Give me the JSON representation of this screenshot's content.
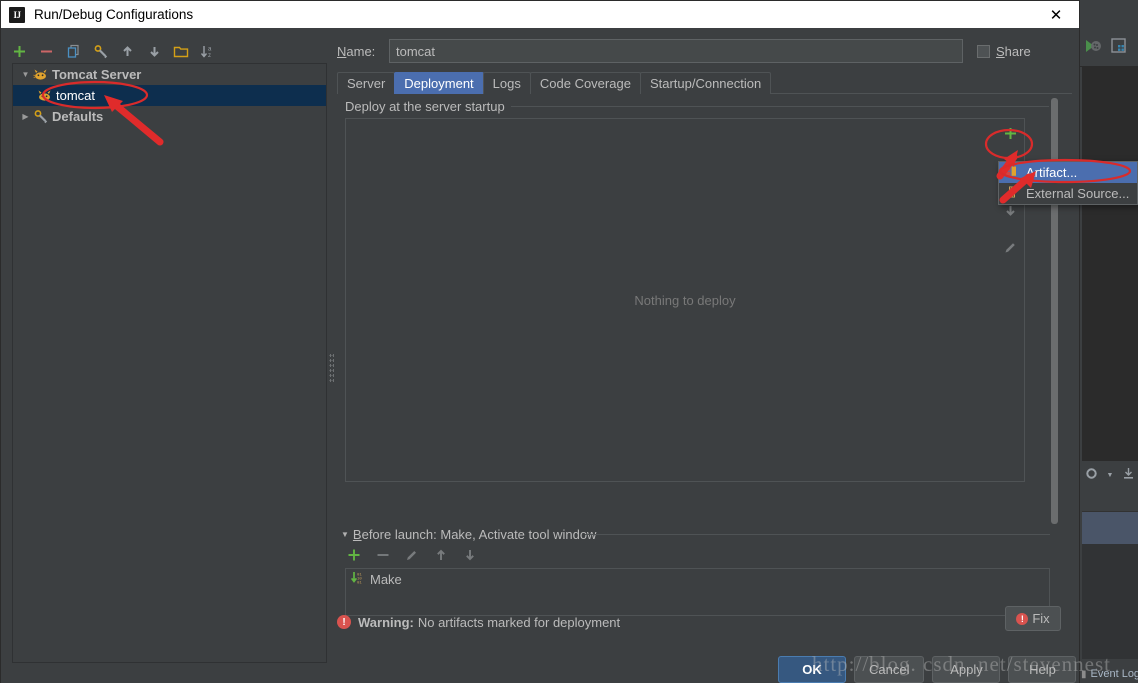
{
  "window": {
    "title": "Run/Debug Configurations",
    "logo_text": "IJ",
    "close_glyph": "✕"
  },
  "left_toolbar": {
    "items": [
      {
        "name": "add-configuration-button",
        "icon": "plus-icon",
        "glyph": "+"
      },
      {
        "name": "remove-configuration-button",
        "icon": "minus-icon",
        "glyph": "−"
      },
      {
        "name": "copy-configuration-button",
        "icon": "copy-icon",
        "glyph": "❐"
      },
      {
        "name": "edit-defaults-button",
        "icon": "wrench-icon",
        "glyph": "🔧"
      },
      {
        "name": "move-up-button",
        "icon": "arrow-up-icon",
        "glyph": "↑"
      },
      {
        "name": "move-down-button",
        "icon": "arrow-down-icon",
        "glyph": "↓"
      },
      {
        "name": "create-folder-button",
        "icon": "folder-icon",
        "glyph": "🗀"
      },
      {
        "name": "sort-configurations-button",
        "icon": "sort-az-icon",
        "glyph": "↓"
      }
    ]
  },
  "tree": {
    "nodes": [
      {
        "label": "Tomcat Server",
        "icon": "tomcat-icon",
        "expanded": true,
        "selected": false,
        "level": 0,
        "twisty": "▼"
      },
      {
        "label": "tomcat",
        "icon": "tomcat-icon",
        "expanded": false,
        "selected": true,
        "level": 1,
        "twisty": ""
      },
      {
        "label": "Defaults",
        "icon": "wrench-icon",
        "expanded": false,
        "selected": false,
        "level": 0,
        "twisty": "▶"
      }
    ]
  },
  "form": {
    "name_label": "Name:",
    "name_label_mnemonic": "N",
    "name_value": "tomcat",
    "share_label": "Share",
    "share_label_mnemonic": "S",
    "share_checked": false
  },
  "tabs": [
    {
      "label": "Server",
      "active": false
    },
    {
      "label": "Deployment",
      "active": true
    },
    {
      "label": "Logs",
      "active": false
    },
    {
      "label": "Code Coverage",
      "active": false
    },
    {
      "label": "Startup/Connection",
      "active": false
    }
  ],
  "deployment": {
    "group_label": "Deploy at the server startup",
    "empty_text": "Nothing to deploy",
    "toolbar": [
      {
        "name": "add-deployment-button",
        "icon": "plus-icon",
        "glyph": "+"
      },
      {
        "name": "move-deployment-down-button",
        "icon": "arrow-down-icon",
        "glyph": "↓"
      },
      {
        "name": "edit-deployment-button",
        "icon": "pencil-icon",
        "glyph": "✎"
      }
    ]
  },
  "popup_menu": {
    "items": [
      {
        "label": "Artifact...",
        "icon": "artifact-icon",
        "highlighted": true
      },
      {
        "label": "External Source...",
        "icon": "external-source-icon",
        "highlighted": false
      }
    ]
  },
  "before_launch": {
    "header": "Before launch: Make, Activate tool window",
    "header_mnemonic": "B",
    "twisty": "▼",
    "toolbar": [
      {
        "name": "add-task-button",
        "icon": "plus-icon",
        "glyph": "+"
      },
      {
        "name": "remove-task-button",
        "icon": "minus-icon",
        "glyph": "−"
      },
      {
        "name": "edit-task-button",
        "icon": "pencil-icon",
        "glyph": "✎"
      },
      {
        "name": "task-move-up-button",
        "icon": "arrow-up-icon",
        "glyph": "↑"
      },
      {
        "name": "task-move-down-button",
        "icon": "arrow-down-icon",
        "glyph": "↓"
      }
    ],
    "tasks": [
      {
        "label": "Make",
        "icon": "make-build-icon"
      }
    ]
  },
  "warning": {
    "icon": "warning-icon",
    "icon_glyph": "!",
    "prefix": "Warning:",
    "message": "No artifacts marked for deployment",
    "fix_label": "Fix",
    "fix_icon": "warning-icon"
  },
  "dialog_buttons": [
    {
      "label": "OK",
      "primary": true,
      "name": "ok-button"
    },
    {
      "label": "Cancel",
      "primary": false,
      "name": "cancel-button"
    },
    {
      "label": "Apply",
      "primary": false,
      "name": "apply-button"
    },
    {
      "label": "Help",
      "primary": false,
      "name": "help-button"
    }
  ],
  "ide_background": {
    "status_text": "Event Log",
    "toolbar_icons": [
      "run-with-coverage-icon",
      "maven-projects-icon"
    ],
    "gear_icon": "gear-icon",
    "collapse_icon": "collapse-all-icon"
  },
  "watermark": {
    "text": "http://blog. csdn. net/stevennest"
  },
  "colors": {
    "accent_blue": "#4b6eaf",
    "selection_navy": "#0d2e4e",
    "dialog_bg": "#3c3f41",
    "annotation_red": "#e03030",
    "green_plus": "#62b543",
    "warning_red": "#d9534f",
    "ide_line_blue": "#3592c4"
  }
}
